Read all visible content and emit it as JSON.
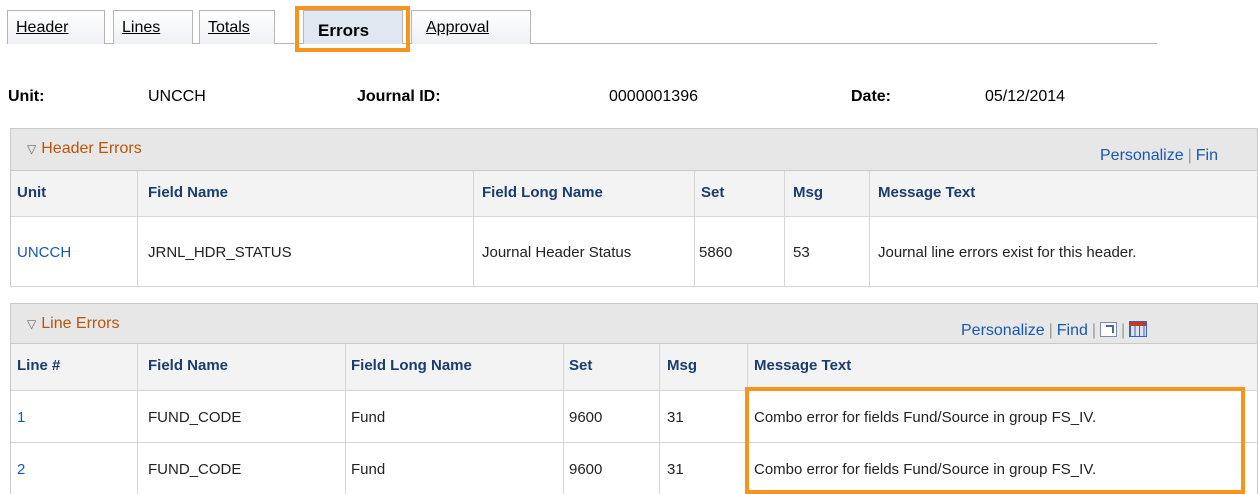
{
  "tabs": [
    {
      "label": "Header"
    },
    {
      "label": "Lines"
    },
    {
      "label": "Totals"
    },
    {
      "label": "Errors"
    },
    {
      "label": "Approval"
    }
  ],
  "info": {
    "unit_label": "Unit:",
    "unit_value": "UNCCH",
    "journal_label": "Journal ID:",
    "journal_value": "0000001396",
    "date_label": "Date:",
    "date_value": "05/12/2014"
  },
  "header_errors": {
    "title": "Header Errors",
    "personalize": "Personalize",
    "find": "Fin",
    "columns": [
      "Unit",
      "Field Name",
      "Field Long Name",
      "Set",
      "Msg",
      "Message Text"
    ],
    "rows": [
      [
        "UNCCH",
        "JRNL_HDR_STATUS",
        "Journal Header Status",
        "5860",
        "53",
        "Journal line errors exist for this header."
      ]
    ]
  },
  "line_errors": {
    "title": "Line Errors",
    "personalize": "Personalize",
    "find": "Find",
    "columns": [
      "Line #",
      "Field Name",
      "Field Long Name",
      "Set",
      "Msg",
      "Message Text"
    ],
    "rows": [
      [
        "1",
        "FUND_CODE",
        "Fund",
        "9600",
        "31",
        "Combo error for fields Fund/Source in group FS_IV."
      ],
      [
        "2",
        "FUND_CODE",
        "Fund",
        "9600",
        "31",
        "Combo error for fields Fund/Source in group FS_IV."
      ]
    ]
  },
  "colors": {
    "highlight": "#f7941d",
    "link": "#1757b4",
    "section_title": "#b8540c"
  }
}
